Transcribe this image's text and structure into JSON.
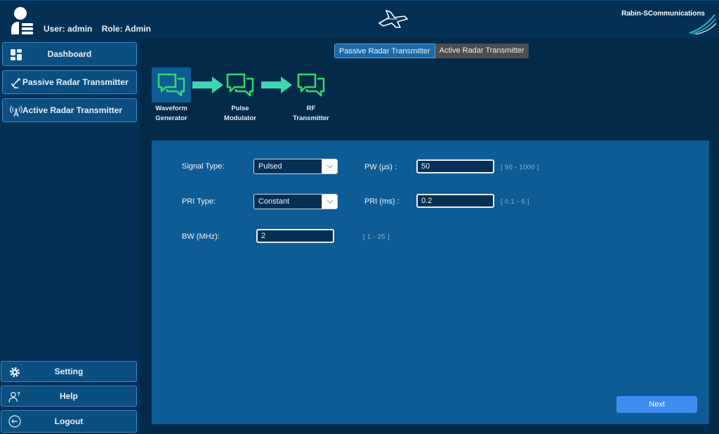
{
  "header": {
    "user_text": "User: admin",
    "role_text": "Role: Admin",
    "brand": "Rabin-SCommunications"
  },
  "sidebar": {
    "top_items": [
      {
        "label": "Dashboard",
        "icon": "dashboard-icon"
      },
      {
        "label": "Passive Radar Transmitter",
        "icon": "satellite-dish-icon"
      },
      {
        "label": "Active Radar Transmitter",
        "icon": "antenna-icon"
      }
    ],
    "bottom_items": [
      {
        "label": "Setting",
        "icon": "gear-icon"
      },
      {
        "label": "Help",
        "icon": "user-question-icon"
      },
      {
        "label": "Logout",
        "icon": "logout-icon"
      }
    ]
  },
  "mode_toggle": {
    "options": [
      "Passive Radar Transmitter",
      "Active Radar Transmitter"
    ],
    "selected": "Passive Radar Transmitter"
  },
  "steps": [
    {
      "line1": "Waveform",
      "line2": "Generator"
    },
    {
      "line1": "Pulse",
      "line2": "Modulator"
    },
    {
      "line1": "RF",
      "line2": "Transmitter"
    }
  ],
  "form": {
    "signal_type": {
      "label": "Signal Type:",
      "value": "Pulsed"
    },
    "pri_type": {
      "label": "PRI Type:",
      "value": "Constant"
    },
    "bw": {
      "label": "BW (MHz):",
      "value": "2",
      "range": "[ 1 - 25 ]"
    },
    "pw": {
      "label": "PW (µs) :",
      "value": "50",
      "range": "[ 50 - 1000 ]"
    },
    "pri": {
      "label": "PRI (ms) :",
      "value": "0.2",
      "range": "[ 0.1 - 5 ]"
    }
  },
  "next_label": "Next",
  "colors": {
    "accent_green": "#2fd96a",
    "panel_blue": "#0e5c95",
    "next_blue": "#3d8ef0"
  }
}
